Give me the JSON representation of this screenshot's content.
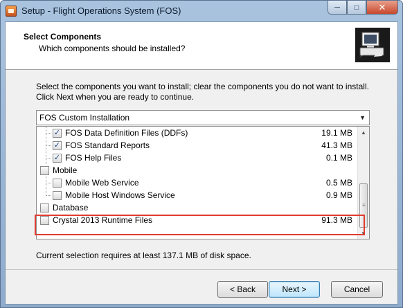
{
  "window": {
    "title": "Setup - Flight Operations System (FOS)",
    "icons": {
      "app": "setup-app-icon",
      "minimize": "minimize-icon",
      "maximize": "maximize-icon",
      "close": "close-icon"
    }
  },
  "header": {
    "title": "Select Components",
    "subtitle": "Which components should be installed?",
    "icon": "computer-install-icon"
  },
  "intro_text": "Select the components you want to install; clear the components you do not want to install. Click Next when you are ready to continue.",
  "setup_type": {
    "selected": "FOS Custom Installation",
    "icon": "chevron-down-icon"
  },
  "components": [
    {
      "label": "FOS Data Definition Files (DDFs)",
      "size": "19.1 MB",
      "checked": true,
      "level": 1
    },
    {
      "label": "FOS Standard Reports",
      "size": "41.3 MB",
      "checked": true,
      "level": 1
    },
    {
      "label": "FOS Help Files",
      "size": "0.1 MB",
      "checked": true,
      "level": 1
    },
    {
      "label": "Mobile",
      "size": "",
      "checked": false,
      "level": 0
    },
    {
      "label": "Mobile Web Service",
      "size": "0.5 MB",
      "checked": false,
      "level": 1
    },
    {
      "label": "Mobile Host Windows Service",
      "size": "0.9 MB",
      "checked": false,
      "level": 1
    },
    {
      "label": "Database",
      "size": "",
      "checked": false,
      "level": 0
    },
    {
      "label": "Crystal 2013 Runtime Files",
      "size": "91.3 MB",
      "checked": false,
      "level": 0
    }
  ],
  "disk_space_text": "Current selection requires at least 137.1 MB of disk space.",
  "buttons": {
    "back": "< Back",
    "next": "Next >",
    "cancel": "Cancel"
  },
  "colors": {
    "highlight_border": "#e03c31",
    "check_mark": "#1e3f8a"
  }
}
